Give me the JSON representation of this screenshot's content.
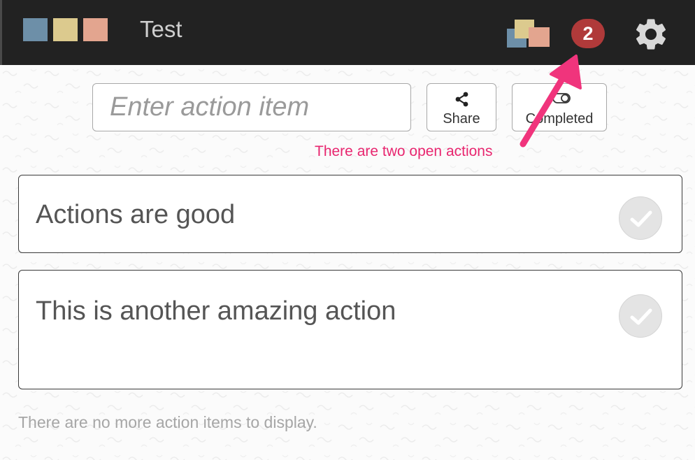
{
  "header": {
    "logo_colors": [
      "#6d8fa8",
      "#dcca8e",
      "#e3a58f"
    ],
    "board_title": "Test",
    "boards_icon": "boards-icon",
    "open_actions_count": "2",
    "badge_color": "#b03a3a",
    "settings_icon": "gear-icon"
  },
  "toolbar": {
    "action_input_placeholder": "Enter action item",
    "action_input_value": "",
    "share_label": "Share",
    "share_icon": "share-icon",
    "completed_label": "Completed",
    "completed_icon": "toggle-icon"
  },
  "annotation": {
    "text": "There are two open actions",
    "color": "#e8266f"
  },
  "actions": [
    {
      "text": "Actions are good",
      "icon": "checkmark-icon"
    },
    {
      "text": "This is another amazing action",
      "icon": "checkmark-icon"
    }
  ],
  "empty_message": "There are no more action items to display."
}
